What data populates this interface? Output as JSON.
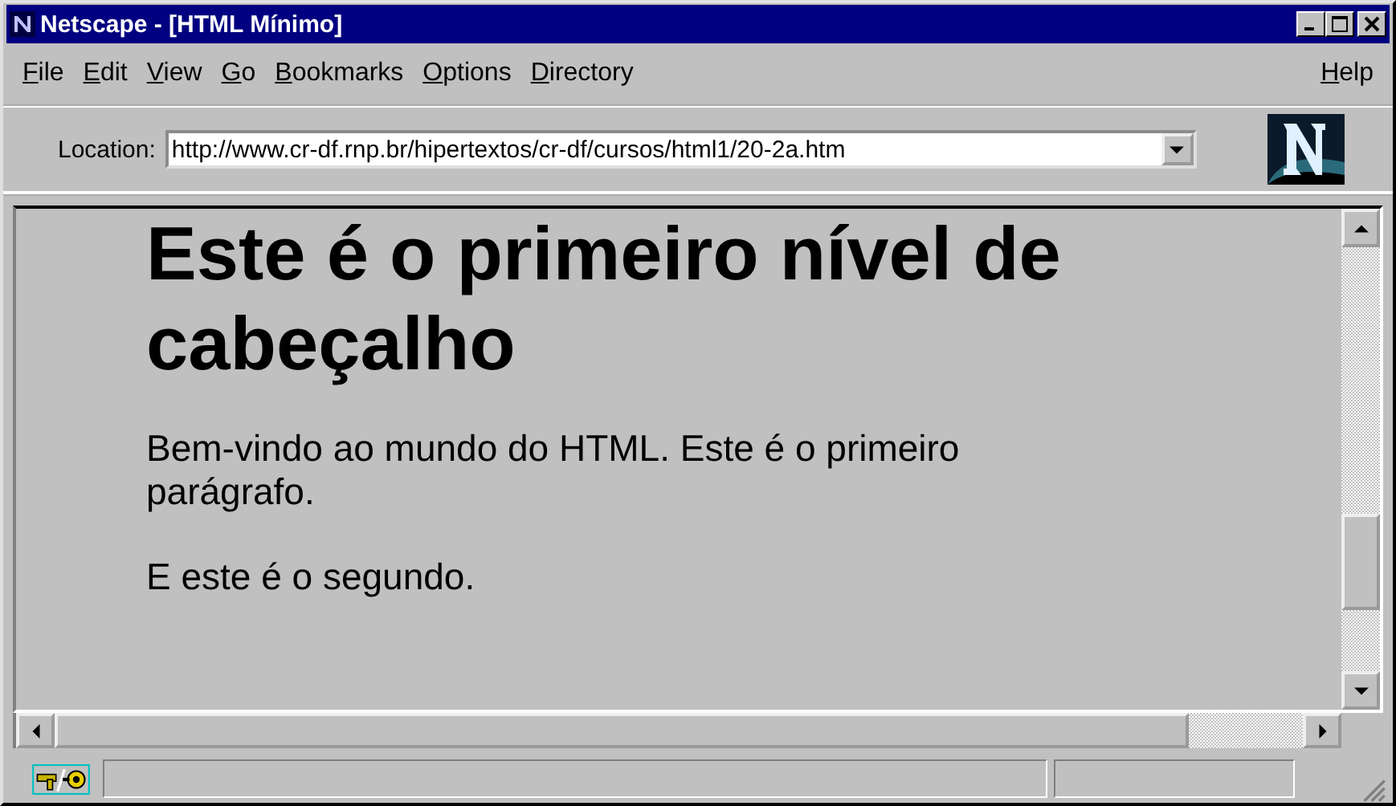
{
  "window": {
    "title": "Netscape - [HTML Mínimo]"
  },
  "menu": [
    "File",
    "Edit",
    "View",
    "Go",
    "Bookmarks",
    "Options",
    "Directory"
  ],
  "help_menu": "Help",
  "location": {
    "label": "Location:",
    "value": "http://www.cr-df.rnp.br/hipertextos/cr-df/cursos/html1/20-2a.htm"
  },
  "content": {
    "heading": "Este é o primeiro nível de cabeçalho",
    "paragraphs": [
      "Bem-vindo ao mundo do HTML. Este é o primeiro parágrafo.",
      "E este é o segundo."
    ]
  }
}
